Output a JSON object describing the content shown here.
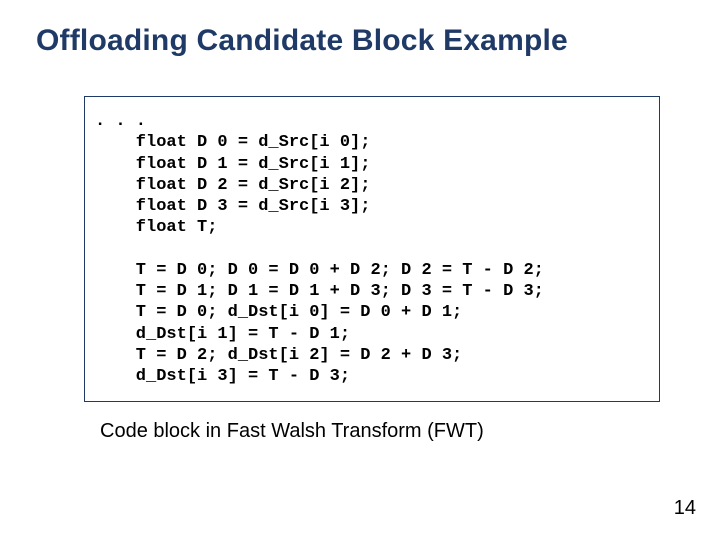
{
  "title": "Offloading Candidate Block Example",
  "code": ". . .\n    float D 0 = d_Src[i 0];\n    float D 1 = d_Src[i 1];\n    float D 2 = d_Src[i 2];\n    float D 3 = d_Src[i 3];\n    float T;\n\n    T = D 0; D 0 = D 0 + D 2; D 2 = T - D 2;\n    T = D 1; D 1 = D 1 + D 3; D 3 = T - D 3;\n    T = D 0; d_Dst[i 0] = D 0 + D 1;\n    d_Dst[i 1] = T - D 1;\n    T = D 2; d_Dst[i 2] = D 2 + D 3;\n    d_Dst[i 3] = T - D 3;",
  "caption": "Code block in Fast Walsh Transform (FWT)",
  "page_number": "14"
}
